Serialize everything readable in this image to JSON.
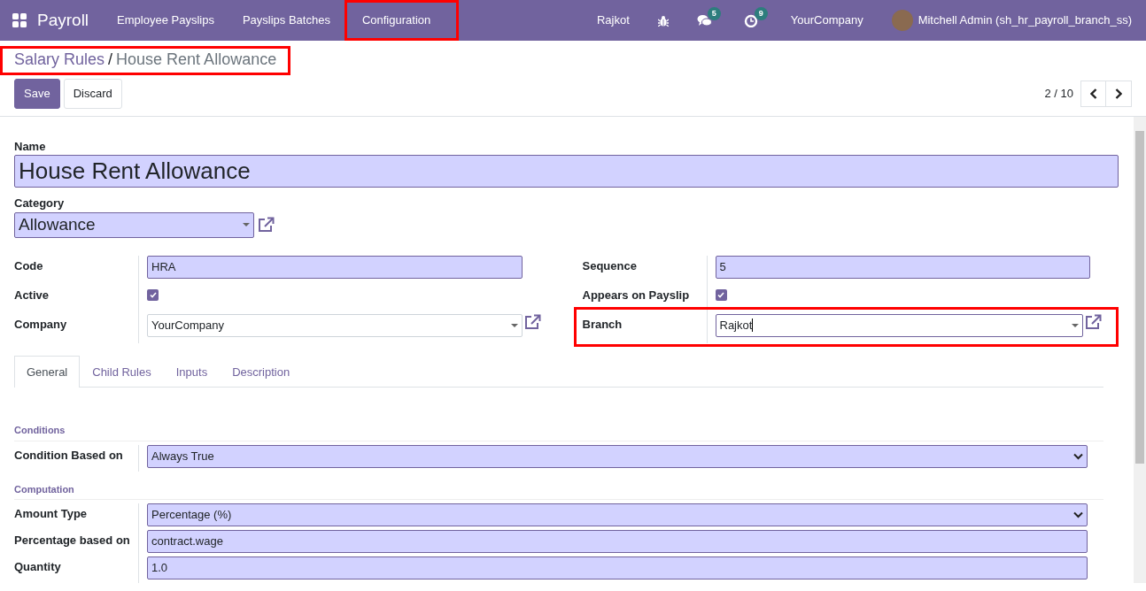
{
  "navbar": {
    "app": "Payroll",
    "menu": [
      {
        "label": "Employee Payslips",
        "highlighted": false
      },
      {
        "label": "Payslips Batches",
        "highlighted": false
      },
      {
        "label": "Configuration",
        "highlighted": true
      }
    ],
    "branch": "Rajkot",
    "messages_count": "5",
    "activities_count": "9",
    "company": "YourCompany",
    "user": "Mitchell Admin (sh_hr_payroll_branch_ss)"
  },
  "breadcrumb": {
    "items": [
      "Salary Rules",
      "House Rent Allowance"
    ],
    "separator": "/",
    "highlighted": true
  },
  "buttons": [
    {
      "label": "Save",
      "kind": "primary"
    },
    {
      "label": "Discard",
      "kind": "secondary"
    }
  ],
  "pager": "2 / 10",
  "form": {
    "name_label": "Name",
    "name": "House Rent Allowance",
    "category_label": "Category",
    "category": "Allowance",
    "left_fields": [
      {
        "label": "Code",
        "kind": "text",
        "value": "HRA",
        "required": true
      },
      {
        "label": "Active",
        "kind": "checkbox",
        "checked": true
      },
      {
        "label": "Company",
        "kind": "many2one",
        "value": "YourCompany",
        "required": false,
        "focused": false,
        "highlighted": false
      }
    ],
    "right_fields": [
      {
        "label": "Sequence",
        "kind": "text",
        "value": "5",
        "required": true
      },
      {
        "label": "Appears on Payslip",
        "kind": "checkbox",
        "checked": true
      },
      {
        "label": "Branch",
        "kind": "many2one",
        "value": "Rajkot",
        "required": false,
        "focused": true,
        "highlighted": true
      }
    ],
    "tabs": [
      {
        "label": "General",
        "selected": true
      },
      {
        "label": "Child Rules",
        "selected": false
      },
      {
        "label": "Inputs",
        "selected": false
      },
      {
        "label": "Description",
        "selected": false
      }
    ],
    "sections": [
      {
        "title": "Conditions",
        "fields": [
          {
            "label": "Condition Based on",
            "kind": "select",
            "value": "Always True"
          }
        ]
      },
      {
        "title": "Computation",
        "fields": [
          {
            "label": "Amount Type",
            "kind": "select",
            "value": "Percentage (%)"
          },
          {
            "label": "Percentage based on",
            "kind": "text",
            "value": "contract.wage",
            "required": true
          },
          {
            "label": "Quantity",
            "kind": "text",
            "value": "1.0",
            "required": true
          }
        ]
      }
    ]
  }
}
